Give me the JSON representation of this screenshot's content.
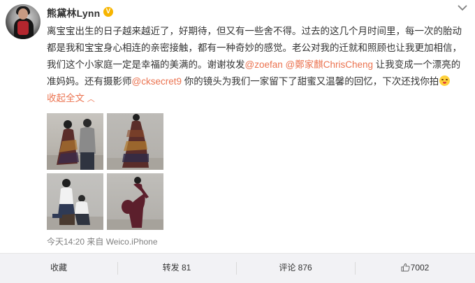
{
  "post": {
    "username": "熊黛林Lynn",
    "verified_badge": "V",
    "text_segments": [
      {
        "type": "text",
        "value": "离宝宝出生的日子越来越近了，好期待，但又有一些舍不得。过去的这几个月时间里，每一次的胎动都是我和宝宝身心相连的亲密接触，都有一种奇妙的感觉。老公对我的迁就和照顾也让我更加相信，我们这个小家庭一定是幸福的美满的。谢谢妆发"
      },
      {
        "type": "mention",
        "value": "@zoefan"
      },
      {
        "type": "text",
        "value": " "
      },
      {
        "type": "mention",
        "value": "@鄭家麒ChrisCheng"
      },
      {
        "type": "text",
        "value": " 让我变成一个漂亮的准妈妈。还有摄影师"
      },
      {
        "type": "mention",
        "value": "@cksecret9"
      },
      {
        "type": "text",
        "value": " 你的镜头为我们一家留下了甜蜜又温馨的回忆，下次还找你拍"
      }
    ],
    "collapse_label": "收起全文",
    "timestamp": "今天14:20 来自 Weico.iPhone"
  },
  "actions": {
    "favorite_label": "收藏",
    "repost_label": "转发 81",
    "comment_label": "评论 876",
    "like_count": "7002"
  },
  "icons": {
    "more": "chevron-down-icon",
    "verified": "verified-badge-icon",
    "emoji": "grin-emoji-icon",
    "collapse": "chevron-up-icon",
    "like": "thumbs-up-icon"
  },
  "colors": {
    "mention": "#eb7350",
    "verified": "#f7b500",
    "action_bar": "#f2f2f5"
  }
}
